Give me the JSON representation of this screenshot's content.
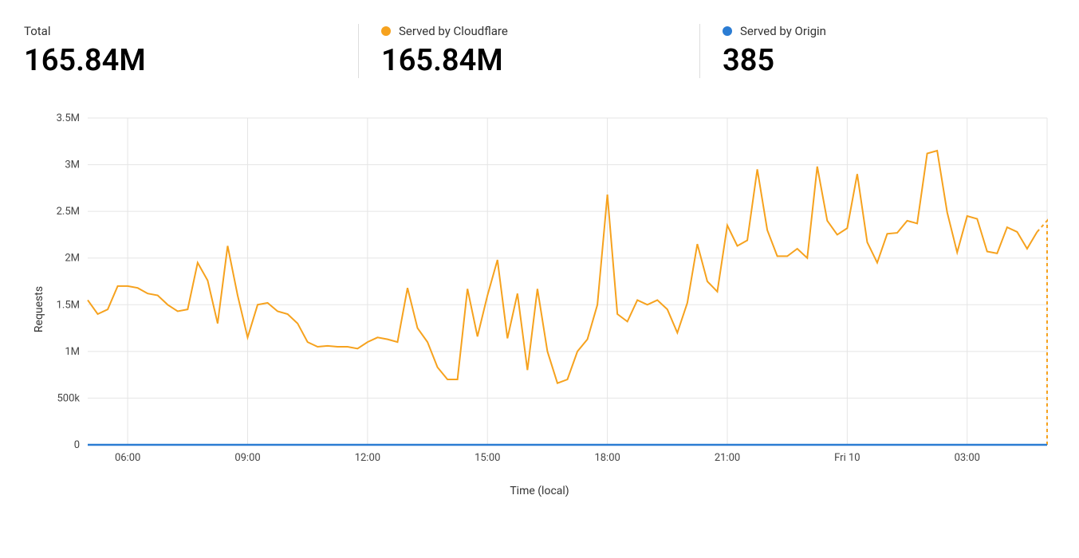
{
  "stats": {
    "total": {
      "label": "Total",
      "value": "165.84M"
    },
    "cloudflare": {
      "label": "Served by Cloudflare",
      "value": "165.84M",
      "color": "#f6a21e"
    },
    "origin": {
      "label": "Served by Origin",
      "value": "385",
      "color": "#2b7cd3"
    }
  },
  "chart_data": {
    "type": "line",
    "title": "",
    "xlabel": "Time (local)",
    "ylabel": "Requests",
    "ylim": [
      0,
      3500000
    ],
    "y_ticks": [
      0,
      500000,
      1000000,
      1500000,
      2000000,
      2500000,
      3000000,
      3500000
    ],
    "y_tick_labels": [
      "0",
      "500k",
      "1M",
      "1.5M",
      "2M",
      "2.5M",
      "3M",
      "3.5M"
    ],
    "x_tick_indices": [
      4,
      16,
      28,
      40,
      52,
      64,
      76,
      88,
      96
    ],
    "x_tick_labels": [
      "06:00",
      "09:00",
      "12:00",
      "15:00",
      "18:00",
      "21:00",
      "Fri 10",
      "03:00",
      ""
    ],
    "series": [
      {
        "name": "Served by Cloudflare",
        "color": "#f6a21e",
        "values": [
          1550000,
          1400000,
          1450000,
          1700000,
          1700000,
          1680000,
          1620000,
          1600000,
          1500000,
          1430000,
          1450000,
          1950000,
          1760000,
          1300000,
          2130000,
          1600000,
          1150000,
          1500000,
          1520000,
          1430000,
          1400000,
          1300000,
          1100000,
          1050000,
          1060000,
          1050000,
          1050000,
          1030000,
          1100000,
          1150000,
          1130000,
          1100000,
          1680000,
          1250000,
          1100000,
          830000,
          700000,
          700000,
          1670000,
          1160000,
          1600000,
          1980000,
          1140000,
          1620000,
          800000,
          1670000,
          1000000,
          660000,
          700000,
          1000000,
          1130000,
          1500000,
          2680000,
          1400000,
          1320000,
          1550000,
          1500000,
          1550000,
          1450000,
          1200000,
          1520000,
          2150000,
          1750000,
          1640000,
          2350000,
          2130000,
          2190000,
          2950000,
          2300000,
          2020000,
          2020000,
          2100000,
          2000000,
          2980000,
          2400000,
          2250000,
          2320000,
          2900000,
          2170000,
          1950000,
          2260000,
          2270000,
          2400000,
          2370000,
          3120000,
          3150000,
          2490000,
          2060000,
          2450000,
          2420000,
          2070000,
          2050000,
          2330000,
          2280000,
          2100000,
          2280000,
          2400000
        ]
      },
      {
        "name": "Served by Origin",
        "color": "#2b7cd3",
        "values": [
          4,
          4,
          4,
          4,
          4,
          4,
          4,
          4,
          4,
          4,
          4,
          4,
          4,
          4,
          4,
          4,
          4,
          4,
          4,
          4,
          4,
          4,
          4,
          4,
          4,
          4,
          4,
          4,
          4,
          4,
          4,
          4,
          4,
          4,
          4,
          4,
          4,
          4,
          4,
          4,
          4,
          4,
          4,
          4,
          4,
          4,
          4,
          4,
          4,
          4,
          4,
          4,
          4,
          4,
          4,
          4,
          4,
          4,
          4,
          4,
          4,
          4,
          4,
          4,
          4,
          4,
          4,
          4,
          4,
          4,
          4,
          4,
          4,
          4,
          4,
          4,
          4,
          4,
          4,
          4,
          4,
          4,
          4,
          4,
          4,
          4,
          4,
          4,
          4,
          4,
          4,
          4,
          4,
          4,
          4,
          4,
          4
        ]
      }
    ]
  }
}
